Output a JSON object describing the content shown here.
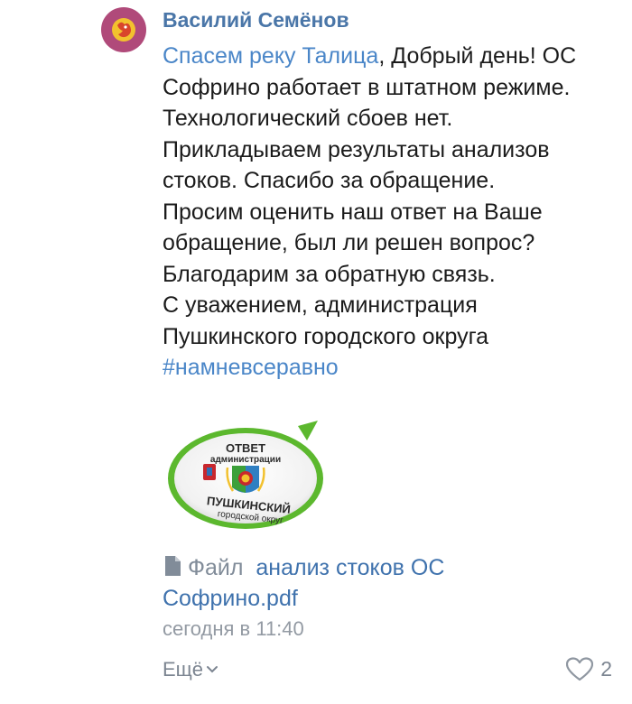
{
  "comment": {
    "author": "Василий Семёнов",
    "reply_to": "Спасем реку Талица",
    "text_lines": [
      ", Добрый день! ОС",
      "Софрино работает в штатном режиме.",
      "Технологический сбоев нет.",
      "Прикладываем результаты анализов",
      "стоков. Спасибо за обращение.",
      "Просим оценить наш ответ на Ваше",
      "обращение, был ли решен вопрос?",
      "Благодарим за обратную связь.",
      "С уважением, администрация",
      "Пушкинского городского округа"
    ],
    "hashtag": "#намневсеравно",
    "image_text": {
      "line1": "ОТВЕТ",
      "line2": "администрации",
      "line3": "ПУШКИНСКИЙ",
      "line4": "городской округ"
    },
    "file": {
      "icon": "document-icon",
      "label": "Файл",
      "name_part1": "анализ стоков ОС",
      "name_part2": "Софрино.pdf"
    },
    "timestamp": "сегодня в 11:40",
    "more_label": "Ещё",
    "likes_count": "2"
  },
  "colors": {
    "author": "#4a76a8",
    "link": "#4a86c8",
    "meta": "#939aa3",
    "avatar_bg": "#b04a7a",
    "badge_green": "#5cb82e"
  }
}
